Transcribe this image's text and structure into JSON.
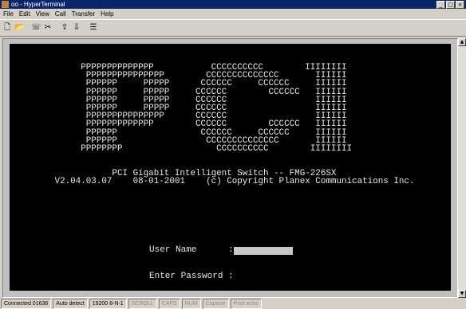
{
  "window": {
    "title": "oo - HyperTerminal",
    "controls": [
      "_",
      "□",
      "×"
    ]
  },
  "menubar": [
    "File",
    "Edit",
    "View",
    "Call",
    "Transfer",
    "Help"
  ],
  "toolbar": [
    {
      "name": "new-icon",
      "glyph": "🗋"
    },
    {
      "name": "open-icon",
      "glyph": "📂"
    },
    {
      "name": "call-icon",
      "glyph": "☏"
    },
    {
      "name": "disconnect-icon",
      "glyph": "✂"
    },
    {
      "name": "send-icon",
      "glyph": "⇪"
    },
    {
      "name": "receive-icon",
      "glyph": "⇩"
    },
    {
      "name": "properties-icon",
      "glyph": "☰"
    }
  ],
  "terminal": {
    "banner_lines": [
      "      PPPPPPPPPPPPPP           CCCCCCCCCC        IIIIIIII",
      "       PPPPPPPPPPPPPPP        CCCCCCCCCCCCCC       IIIIII",
      "       PPPPPP     PPPPP      CCCCCC     CCCCCC     IIIIII",
      "       PPPPPP     PPPPP     CCCCCC        CCCCCC   IIIIII",
      "       PPPPPP     PPPPP     CCCCCC                 IIIIII",
      "       PPPPPP     PPPPP     CCCCCC                 IIIIII",
      "       PPPPPPPPPPPPPPP      CCCCCC                 IIIIII",
      "       PPPPPPPPPPPPP        CCCCCC        CCCCCC   IIIIII",
      "       PPPPPP                CCCCCC     CCCCCC     IIIIII",
      "       PPPPPP                 CCCCCCCCCCCCCC       IIIIII",
      "      PPPPPPPP                  CCCCCCCCCC        IIIIIIII",
      "",
      "",
      "            PCI Gigabit Intelligent Switch -- FMG-226SX",
      " V2.04.03.07    08-01-2001    (c) Copyright Planex Communications Inc."
    ],
    "login": {
      "username_label": "User Name      :",
      "password_label": "Enter Password :"
    }
  },
  "statusbar": [
    {
      "text": "Connected 01636",
      "dim": false
    },
    {
      "text": "Auto detect",
      "dim": false
    },
    {
      "text": "19200 8-N-1",
      "dim": false
    },
    {
      "text": "SCROLL",
      "dim": true
    },
    {
      "text": "CAPS",
      "dim": true
    },
    {
      "text": "NUM",
      "dim": true
    },
    {
      "text": "Capture",
      "dim": true
    },
    {
      "text": "Print echo",
      "dim": true
    }
  ]
}
